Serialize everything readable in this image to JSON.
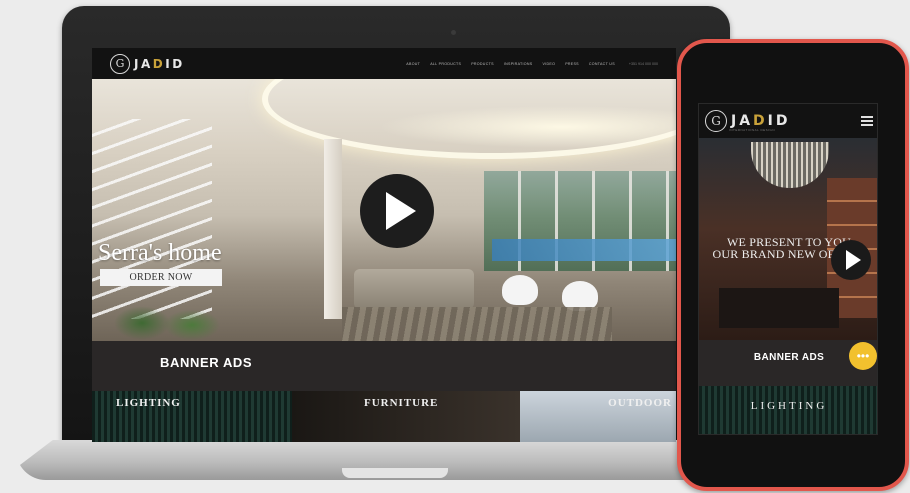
{
  "desktop": {
    "brand": {
      "mark": "G",
      "name_pre": "JA",
      "name_accent": "D",
      "name_post": "ID"
    },
    "nav": {
      "items": [
        "ABOUT",
        "ALL PRODUCTS",
        "PRODUCTS",
        "INSPIRATIONS",
        "VIDEO",
        "PRESS",
        "CONTACT US"
      ],
      "phone": "+351 914 000 000"
    },
    "hero": {
      "title": "Serra's home",
      "cta": "ORDER NOW"
    },
    "banner": {
      "label": "BANNER ADS"
    },
    "categories": [
      "LIGHTING",
      "FURNITURE",
      "OUTDOOR"
    ]
  },
  "mobile": {
    "brand": {
      "mark": "G",
      "name_pre": "JA",
      "name_accent": "D",
      "name_post": "ID",
      "tagline": "INTERNATIONAL DESIGN"
    },
    "hero": {
      "line1": "WE PRESENT TO YOU",
      "line2": "OUR BRAND NEW OFFICE!"
    },
    "banner": {
      "label": "BANNER ADS"
    },
    "category": "LIGHTING",
    "chat_icon": "chat-bubble-icon"
  },
  "colors": {
    "accent": "#c9a23a",
    "phone_frame": "#e2574c",
    "chat": "#f2c12e",
    "banner_bg": "#2a2727"
  }
}
